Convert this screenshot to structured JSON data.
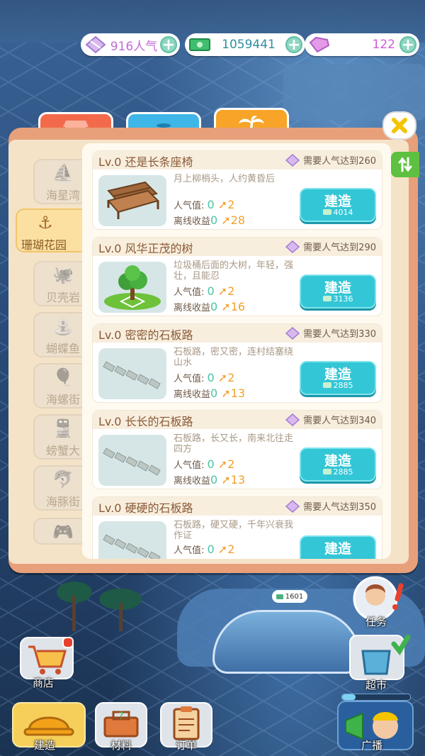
{
  "resources": {
    "popularity": "916人气",
    "money": "1059441",
    "gems": "122"
  },
  "tabs": [
    {
      "icon": "shop-icon",
      "color": "#f26a4a"
    },
    {
      "icon": "fountain-icon",
      "color": "#3fb6e8"
    },
    {
      "icon": "palm-tree-icon",
      "color": "#f7a428"
    }
  ],
  "categories": [
    {
      "label": "海星湾",
      "icon": "sailboat-icon"
    },
    {
      "label": "珊瑚花园",
      "icon": "anchor-icon",
      "active": true
    },
    {
      "label": "贝壳岩",
      "icon": "octopus-icon"
    },
    {
      "label": "蝴蝶鱼",
      "icon": "fountain-icon"
    },
    {
      "label": "海螺街",
      "icon": "balloon-icon"
    },
    {
      "label": "螃蟹大",
      "icon": "train-icon"
    },
    {
      "label": "海豚街",
      "icon": "dolphin-icon"
    },
    {
      "label": "",
      "icon": "gamepad-icon"
    }
  ],
  "labels": {
    "popularity": "人气值:",
    "income": "离线收益",
    "zero": "0",
    "build": "建造"
  },
  "items": [
    {
      "title": "Lv.0 还是长条座椅",
      "req": "需要人气达到260",
      "desc": "月上柳梢头，人约黄昏后",
      "pop": "2",
      "income": "28",
      "cost": "4014",
      "thumb": "bench"
    },
    {
      "title": "Lv.0 风华正茂的树",
      "req": "需要人气达到290",
      "desc": "垃圾桶后面的大树，年轻，强壮，且能忍",
      "pop": "2",
      "income": "16",
      "cost": "3136",
      "thumb": "tree"
    },
    {
      "title": "Lv.0 密密的石板路",
      "req": "需要人气达到330",
      "desc": "石板路，密又密，连村结塞绕山水",
      "pop": "2",
      "income": "13",
      "cost": "2885",
      "thumb": "path"
    },
    {
      "title": "Lv.0 长长的石板路",
      "req": "需要人气达到340",
      "desc": "石板路，长又长，南来北往走四方",
      "pop": "2",
      "income": "13",
      "cost": "2885",
      "thumb": "path"
    },
    {
      "title": "Lv.0 硬硬的石板路",
      "req": "需要人气达到350",
      "desc": "石板路，硬又硬，千年兴衰我作证",
      "pop": "2",
      "income": "",
      "cost": "",
      "thumb": "path"
    }
  ],
  "map_badge": "1601",
  "bottom": {
    "shop": "商店",
    "build": "建造",
    "material": "材料",
    "order": "订单",
    "task": "任务",
    "market": "超市",
    "broadcast": "广播"
  }
}
